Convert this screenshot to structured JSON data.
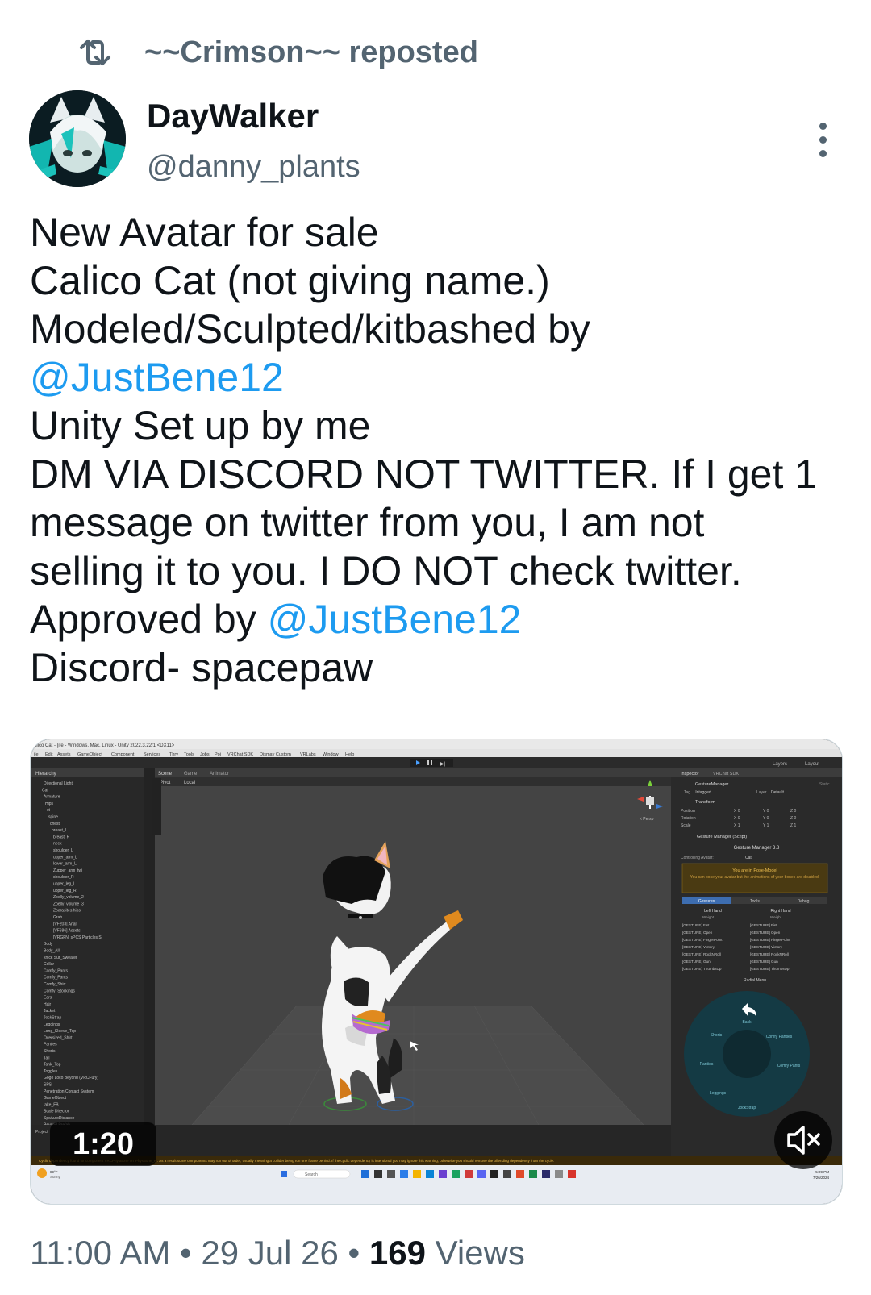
{
  "repost": {
    "icon": "repost-icon",
    "text": "~~Crimson~~ reposted"
  },
  "author": {
    "name": "DayWalker",
    "handle": "@danny_plants",
    "avatar": "avatar-image"
  },
  "menu": {
    "icon": "more-vertical-icon"
  },
  "tweet": {
    "line1": "New Avatar for sale",
    "line2": "Calico Cat (not giving name.)",
    "line3": "Modeled/Sculpted/kitbashed by",
    "mention1": "@JustBene12",
    "line5": "Unity Set up by me",
    "line6": "DM VIA DISCORD NOT TWITTER. If I get 1",
    "line7": "message on twitter from you, I am not",
    "line8": "selling it to you. I DO NOT check twitter.",
    "line9_prefix": "Approved by ",
    "mention2": "@JustBene12",
    "line10": "Discord- spacepaw"
  },
  "media": {
    "duration": "1:20",
    "mute_icon": "mute-icon",
    "unity": {
      "title": "alico Cat - [ife - Windows, Mac, Linux - Unity 2022.3.22f1 <DX11>",
      "menu": [
        "ile",
        "Edit",
        "Assets",
        "GameObject",
        "Component",
        "Services",
        "Thry",
        "Tools",
        "Jobs",
        "Poi",
        "VRChat SDK",
        "Dismay Custom",
        "VRLabs",
        "Window",
        "Help"
      ],
      "hierarchy_title": "Hierarchy",
      "hierarchy_items": [
        "Directional Light",
        "Cat",
        "Armature",
        "Hips",
        "ct",
        "spine",
        "chest",
        "breast_L",
        "breast_R",
        "neck",
        "shoulder_L",
        "upper_arm_L",
        "lower_arm_L",
        "Zupper_arm_twi",
        "shoulder_R",
        "upper_leg_L",
        "upper_leg_R",
        "Zbelly_volume_2",
        "Zbelly_volume_3",
        "Zparasites.hips",
        "Grab",
        "[VF203] Anal",
        "[VF686] Assets",
        "[VRGFN] sPCS Particles S",
        "Body",
        "Body_All",
        "knick Sur_Sweater",
        "Collar",
        "Comfy_Pants",
        "Comfy_Pants",
        "Comfy_Shirt",
        "Comfy_Stockings",
        "Ears",
        "Hair",
        "Jacket",
        "JockStrap",
        "Leggings",
        "Long_Sleeve_Top",
        "Oversized_Shirt",
        "Panties",
        "Shorts",
        "Tail",
        "Tank_Top",
        "Toggles",
        "Gogo Loco Beyond (VRCFury)",
        "SPS",
        "Penetration Contact System",
        "GameObject",
        "take_FB",
        "Scale Director",
        "SpsAutoDistance",
        "Beyond Prefab"
      ],
      "scene_tabs": [
        "Scene",
        "Game",
        "Animator"
      ],
      "scene_toolbar": [
        "Pivot",
        "Local"
      ],
      "persp": "< Persp",
      "inspector_tabs": [
        "Inspector",
        "VRChat SDK"
      ],
      "right_tabs": [
        "Layers",
        "Layout"
      ],
      "object_name": "GestureManager",
      "static_label": "Static",
      "tag_label": "Tag",
      "tag_value": "Untagged",
      "layer_label": "Layer",
      "layer_value": "Default",
      "transform": "Transform",
      "transform_rows": [
        {
          "label": "Position",
          "x": "X 0",
          "y": "Y 0",
          "z": "Z 0"
        },
        {
          "label": "Rotation",
          "x": "X 0",
          "y": "Y 0",
          "z": "Z 0"
        },
        {
          "label": "Scale",
          "x": "X 1",
          "y": "Y 1",
          "z": "Z 1"
        }
      ],
      "component": "Gesture Manager (Script)",
      "gm_title": "Gesture Manager 3.8",
      "controlling_label": "Controlling Avatar:",
      "controlling_value": "Cat",
      "pose_mode": "You are in Pose-Model",
      "pose_note": "You can pose your avatar but the animations of your bones are disabled!",
      "gm_tabs": [
        "Gestures",
        "Tools",
        "Debug"
      ],
      "left_hand": "Left Hand",
      "right_hand": "Right Hand",
      "weight_label": "Weight",
      "gestures": [
        "[GESTURE] Fist",
        "[GESTURE] Open",
        "[GESTURE] FingerPoint",
        "[GESTURE] Victory",
        "[GESTURE] RockNRoll",
        "[GESTURE] Gun",
        "[GESTURE] ThumbsUp"
      ],
      "radial_title": "Radial Menu",
      "radial_items": [
        "Back",
        "Comfy Panties",
        "Comfy Pants",
        "JockStrap",
        "Leggings",
        "Panties",
        "Shorts"
      ],
      "console": "Cyclic dependency found for component VRCPhysBone on 'PhysBone_R'. As a result some components may run out of order, usually meaning a collider being run one frame behind. If the cyclic dependency is intentional you may ignore this warning, otherwise you should remove the offending dependency from the cycle.",
      "project_label": "Project",
      "weather_temp": "89°F",
      "weather_text": "Sunny",
      "search": "Search",
      "clock_time": "5:09 PM",
      "clock_date": "7/26/2024"
    }
  },
  "meta": {
    "time": "11:00 AM",
    "sep1": " • ",
    "date": "29 Jul 26",
    "sep2": " • ",
    "views_count": "169",
    "views_label": " Views"
  },
  "colors": {
    "link": "#1d9bf0",
    "secondary": "#536471",
    "text": "#0f1419"
  }
}
